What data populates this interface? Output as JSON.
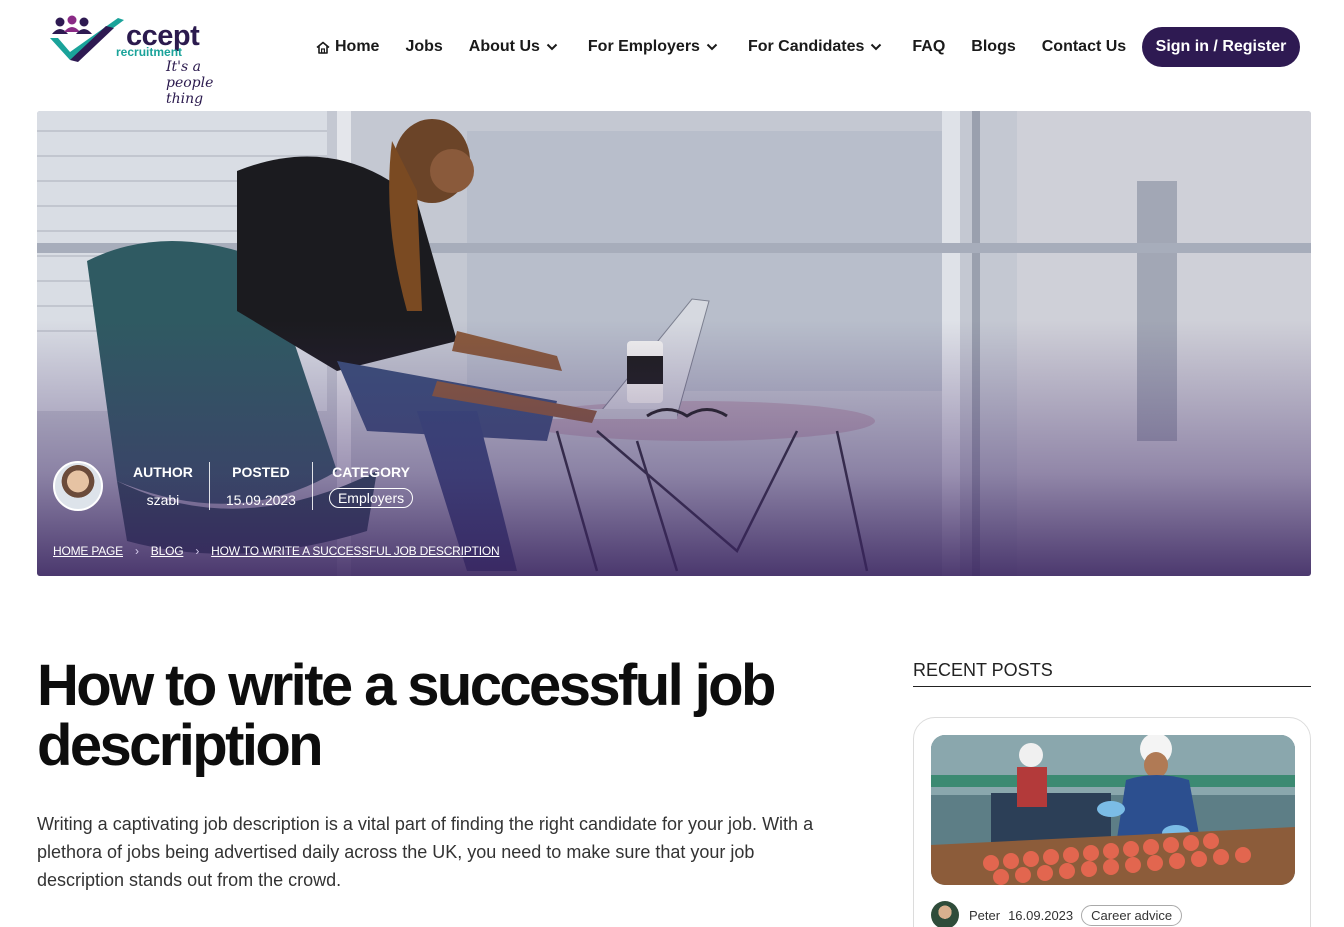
{
  "brand": {
    "name": "ccept",
    "sub": "recruitment",
    "tagline": "It's a people thing"
  },
  "nav": {
    "items": [
      {
        "label": "Home",
        "icon": "home-icon"
      },
      {
        "label": "Jobs"
      },
      {
        "label": "About Us",
        "icon": "chevron-down-icon"
      },
      {
        "label": "For Employers",
        "icon": "chevron-down-icon"
      },
      {
        "label": "For Candidates",
        "icon": "chevron-down-icon"
      },
      {
        "label": "FAQ"
      },
      {
        "label": "Blogs"
      },
      {
        "label": "Contact Us"
      }
    ],
    "signin_label": "Sign in / Register"
  },
  "hero": {
    "meta": {
      "author_label": "AUTHOR",
      "author": "szabi",
      "posted_label": "POSTED",
      "posted": "15.09.2023",
      "category_label": "CATEGORY",
      "category": "Employers"
    },
    "breadcrumbs": [
      "HOME PAGE",
      "BLOG",
      "HOW TO WRITE A SUCCESSFUL JOB DESCRIPTION"
    ]
  },
  "article": {
    "title": "How to write a successful job description",
    "lead": "Writing a captivating job description is a vital part of finding the right candidate for your job. With a plethora of jobs being advertised daily across the UK, you need to make sure that your job description stands out from the crowd."
  },
  "sidebar": {
    "heading": "RECENT POSTS",
    "posts": [
      {
        "author": "Peter",
        "date": "16.09.2023",
        "category": "Career advice"
      }
    ]
  },
  "colors": {
    "brand": "#2e1a52",
    "teal": "#1aa39a",
    "magenta": "#8a2a86"
  }
}
